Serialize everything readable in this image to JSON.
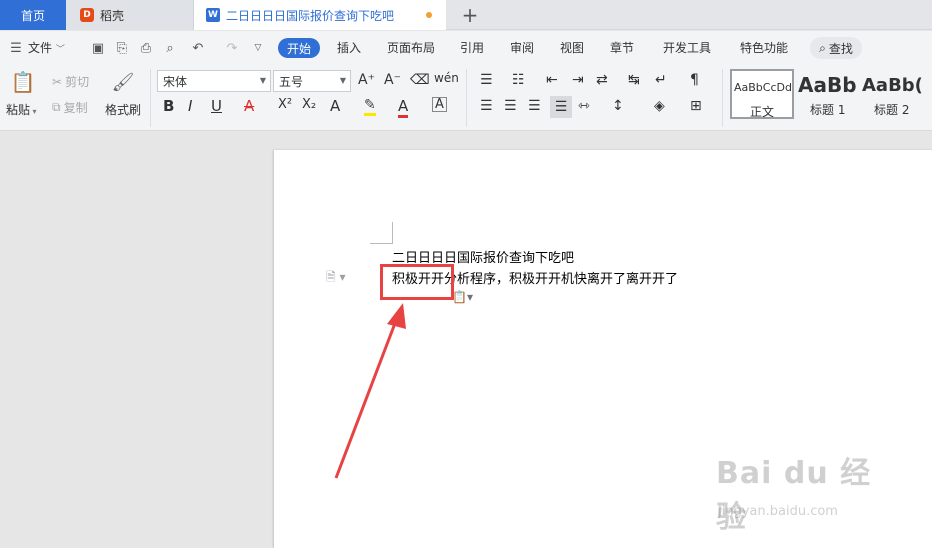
{
  "tabs": {
    "home": "首页",
    "daoke": "稻壳",
    "document": "二日日日日国际报价查询下吃吧",
    "add": "+"
  },
  "menu": {
    "file": "文件",
    "items": [
      "开始",
      "插入",
      "页面布局",
      "引用",
      "审阅",
      "视图",
      "章节",
      "开发工具",
      "特色功能"
    ],
    "search": "查找"
  },
  "ribbon": {
    "paste": "粘贴",
    "cut": "剪切",
    "copy": "复制",
    "format_painter": "格式刷",
    "font_name": "宋体",
    "font_size": "五号",
    "styles": [
      {
        "sample": "AaBbCcDd",
        "name": "正文"
      },
      {
        "sample": "AaBb",
        "name": "标题 1"
      },
      {
        "sample": "AaBb(",
        "name": "标题 2"
      }
    ]
  },
  "document": {
    "line1": "二日日日日国际报价查询下吃吧",
    "line2": "积极开开分析程序，积极开开机快离开了离开开了"
  },
  "watermark": {
    "main": "Bai du 经验",
    "sub": "jingyan.baidu.com"
  },
  "colors": {
    "accent": "#2f6fd6",
    "highlight": "#e84343"
  }
}
